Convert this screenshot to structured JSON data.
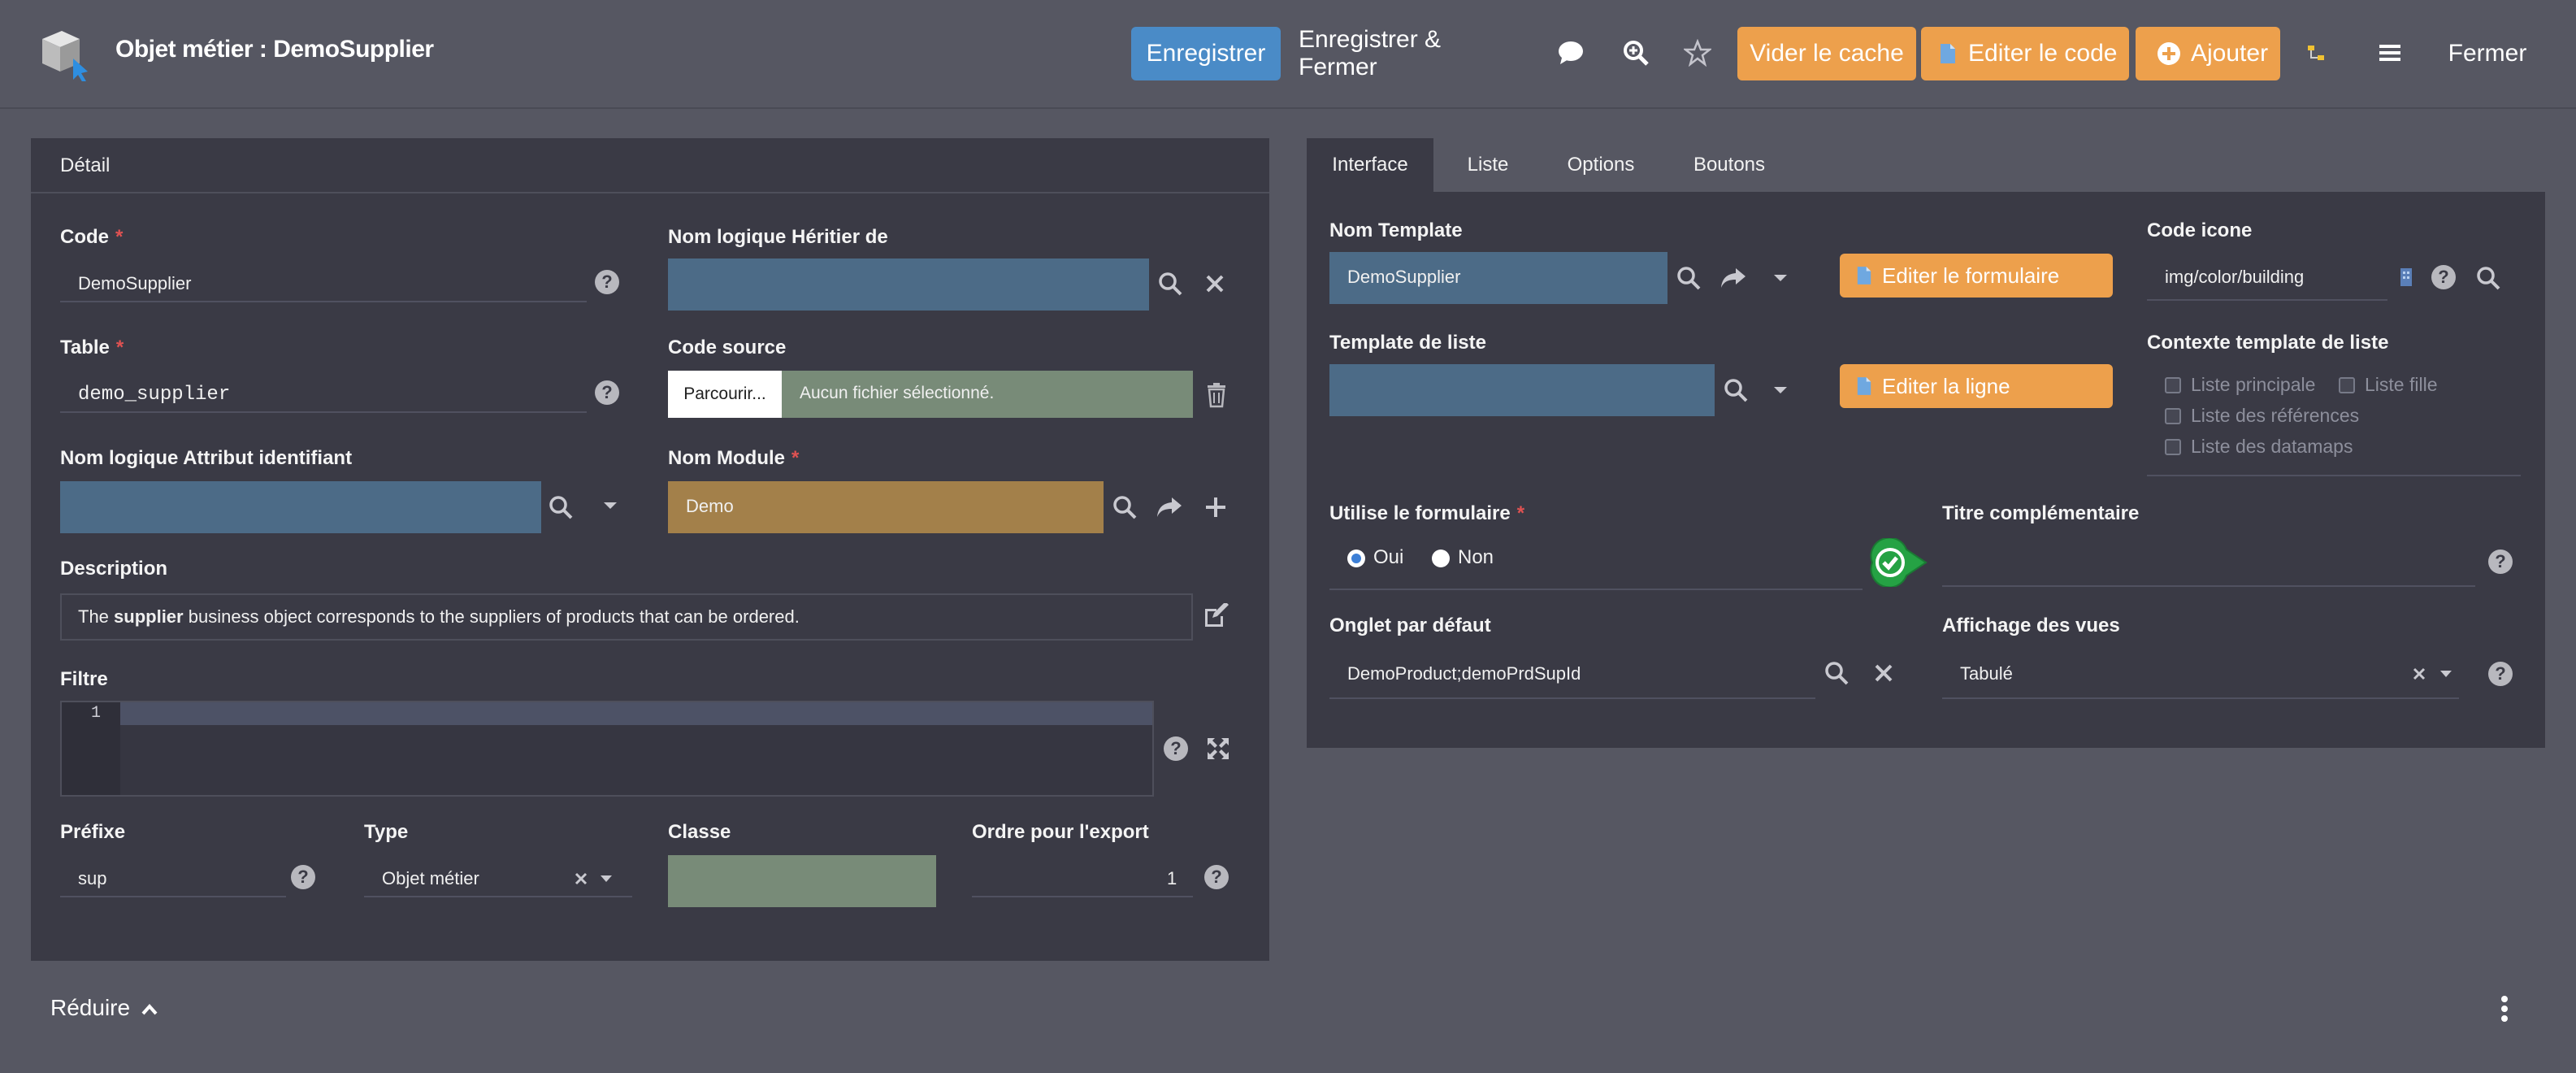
{
  "header": {
    "title": "Objet métier : DemoSupplier",
    "save": "Enregistrer",
    "save_close": "Enregistrer & Fermer",
    "clear_cache": "Vider le cache",
    "edit_code": "Editer le code",
    "add": "Ajouter",
    "close": "Fermer"
  },
  "detail": {
    "title": "Détail",
    "code_label": "Code",
    "code_value": "DemoSupplier",
    "heir_label": "Nom logique Héritier de",
    "table_label": "Table",
    "table_value": "demo_supplier",
    "source_label": "Code source",
    "browse": "Parcourir...",
    "no_file": "Aucun fichier sélectionné.",
    "id_attr_label": "Nom logique Attribut identifiant",
    "module_label": "Nom Module",
    "module_value": "Demo",
    "desc_label": "Description",
    "desc_pre": "The ",
    "desc_bold": "supplier",
    "desc_post": " business object corresponds to the suppliers of products that can be ordered.",
    "filter_label": "Filtre",
    "filter_line": "1",
    "prefix_label": "Préfixe",
    "prefix_value": "sup",
    "type_label": "Type",
    "type_value": "Objet métier",
    "class_label": "Classe",
    "export_label": "Ordre pour l'export",
    "export_value": "1"
  },
  "tabs": [
    "Interface",
    "Liste",
    "Options",
    "Boutons"
  ],
  "interface": {
    "template_label": "Nom Template",
    "template_value": "DemoSupplier",
    "edit_form": "Editer le formulaire",
    "icon_label": "Code icone",
    "icon_value": "img/color/building",
    "list_template_label": "Template de liste",
    "edit_line": "Editer la ligne",
    "context_label": "Contexte template de liste",
    "ctx_main": "Liste principale",
    "ctx_child": "Liste fille",
    "ctx_refs": "Liste des références",
    "ctx_datamaps": "Liste des datamaps",
    "use_form_label": "Utilise le formulaire",
    "yes": "Oui",
    "no": "Non",
    "extra_title_label": "Titre complémentaire",
    "default_tab_label": "Onglet par défaut",
    "default_tab_value": "DemoProduct;demoPrdSupId",
    "views_label": "Affichage des vues",
    "views_value": "Tabulé"
  },
  "footer": {
    "reduce": "Réduire"
  },
  "colors": {
    "primary": "#4a8bc7",
    "orange": "#eda04c",
    "field_blue": "#4c6b87",
    "field_gold": "#a3804a",
    "field_green": "#788b78",
    "panel": "#3a3a45",
    "background": "#565762"
  }
}
